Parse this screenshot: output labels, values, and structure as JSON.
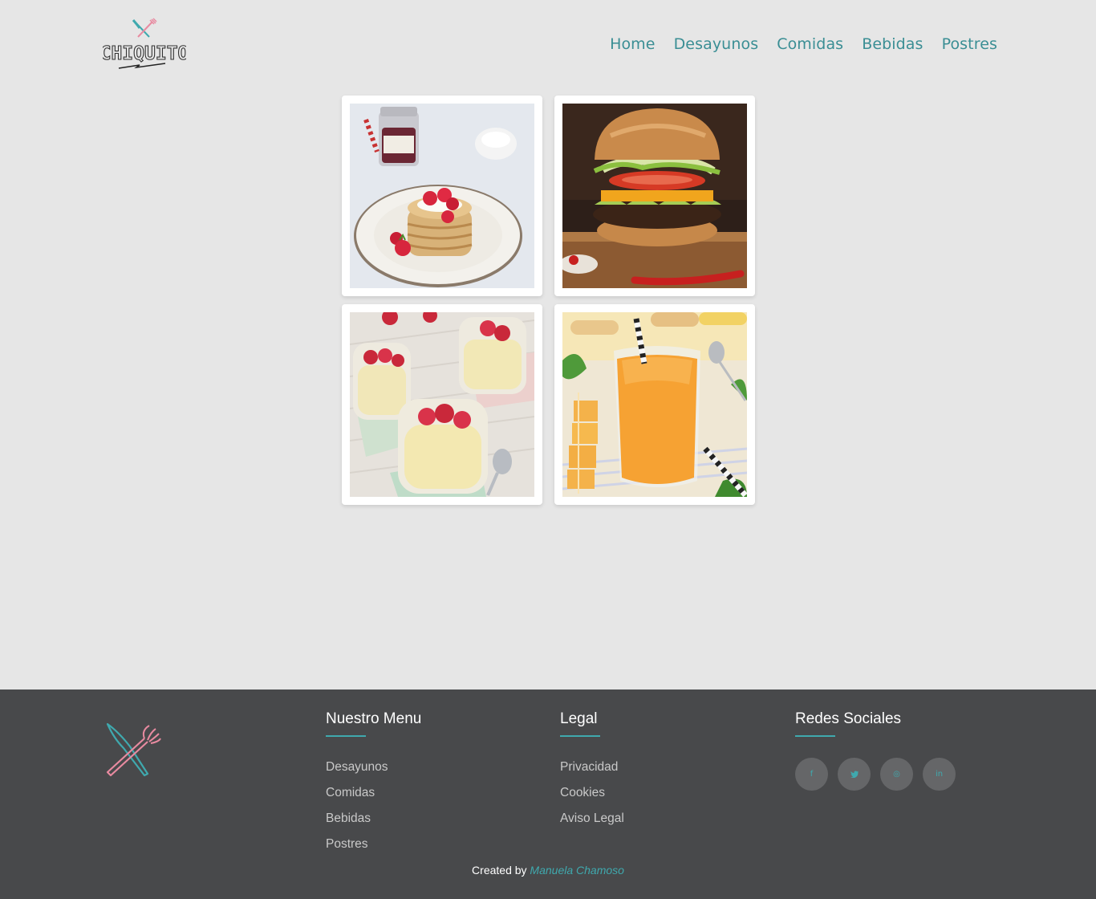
{
  "header": {
    "logo_text": "CHIQUITO",
    "nav": [
      "Home",
      "Desayunos",
      "Comidas",
      "Bebidas",
      "Postres"
    ]
  },
  "gallery": [
    {
      "name": "pancakes"
    },
    {
      "name": "hamburguesa"
    },
    {
      "name": "natillas"
    },
    {
      "name": "zumo"
    }
  ],
  "footer": {
    "menu": {
      "title": "Nuestro Menu",
      "items": [
        "Desayunos",
        "Comidas",
        "Bebidas",
        "Postres"
      ]
    },
    "legal": {
      "title": "Legal",
      "items": [
        "Privacidad",
        "Cookies",
        "Aviso Legal"
      ]
    },
    "social": {
      "title": "Redes Sociales",
      "icons": [
        "f",
        "🐦",
        "◎",
        "in"
      ]
    },
    "credit_prefix": "Created by",
    "credit_author": "Manuela Chamoso"
  },
  "colors": {
    "background": "#e6e6e6",
    "accent": "#3a8e94",
    "footer": "#48494b",
    "pink": "#e88aa0"
  }
}
